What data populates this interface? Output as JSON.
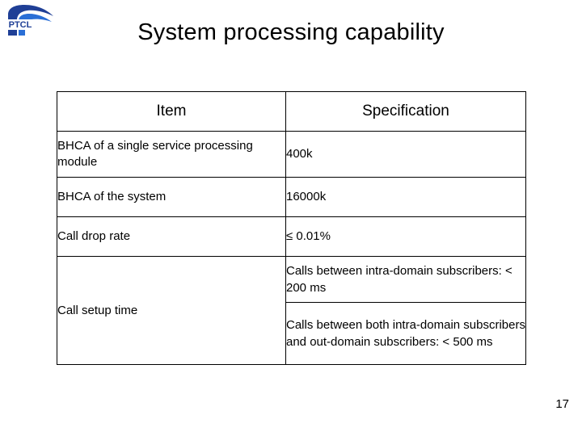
{
  "logo": {
    "name": "ptcl-logo",
    "text": "PTCL",
    "color": "#1f3f96"
  },
  "title": "System processing capability",
  "table": {
    "headers": [
      "Item",
      "Specification"
    ],
    "rows": [
      {
        "item": "BHCA of a single service processing module",
        "spec": "400k"
      },
      {
        "item": "BHCA of the system",
        "spec": "16000k"
      },
      {
        "item": "Call drop rate",
        "spec": "≤ 0.01%"
      }
    ],
    "setup_row": {
      "item": "Call setup time",
      "spec_lines": [
        "Calls between intra-domain subscribers: < 200 ms",
        "Calls between both intra-domain subscribers and out-domain subscribers: < 500 ms"
      ]
    }
  },
  "page_number": "17"
}
